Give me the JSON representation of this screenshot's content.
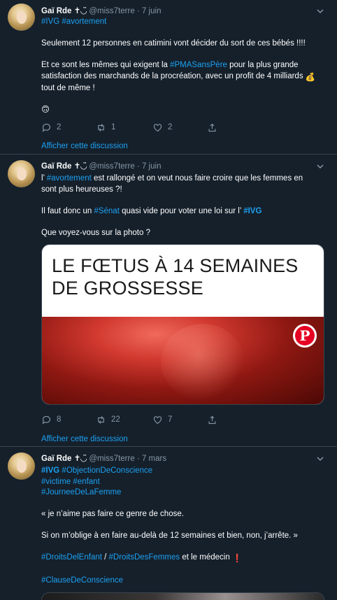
{
  "tweets": [
    {
      "name": "Gaï Rde",
      "name_symbol": "✝◡̈",
      "handle": "@miss7terre",
      "date": "7 juin",
      "hashtags": "#IVG #avortement",
      "text": {
        "l1": "Seulement 12 personnes en catimini vont décider du sort de ces bébés !!!!",
        "l2a": "Et ce sont les mêmes qui exigent la ",
        "l2tag": "#PMASansPère",
        "l2b": " pour la plus grande",
        "l3": "satisfaction des marchands de la procréation, avec un profit de 4 milliards ",
        "l3emoji": "💰",
        "l4": "tout de même !",
        "l5emoji": "🙃"
      },
      "replies": "2",
      "retweets": "1",
      "likes": "2",
      "thread_link": "Afficher cette discussion"
    },
    {
      "name": "Gaï Rde",
      "name_symbol": "✝◡̈",
      "handle": "@miss7terre",
      "date": "7 juin",
      "text": {
        "l1a": "l’ ",
        "l1tag": "#avortement",
        "l1b": " est rallongé et on veut nous faire croire que les femmes en",
        "l2": "sont plus heureuses ?!",
        "l3a": "Il faut donc un ",
        "l3tag1": "#Sénat",
        "l3b": " quasi vide pour voter une loi sur l’ ",
        "l3tag2": "#IVG",
        "l4": "Que voyez-vous sur la photo ?"
      },
      "card": {
        "title_l1": "LE FŒTUS À 14 SEMAINES",
        "title_l2": "DE GROSSESSE",
        "pin_glyph": "P"
      },
      "replies": "8",
      "retweets": "22",
      "likes": "7",
      "thread_link": "Afficher cette discussion"
    },
    {
      "name": "Gaï Rde",
      "name_symbol": "✝◡̈",
      "handle": "@miss7terre",
      "date": "7 mars",
      "text": {
        "h1a": "#IVG",
        "h1b": "#ObjectionDeConscience",
        "h2a": "#victime",
        "h2b": "#enfant",
        "h3": "#JourneeDeLaFemme",
        "l1": "« je n’aime pas faire ce genre de chose.",
        "l2": "Si on m’oblige à en faire au-delà de 12 semaines et bien, non, j’arrête. »",
        "l3tag1": "#DroitsDelEnfant",
        "l3sep": " / ",
        "l3tag2": "#DroitsDesFemmes",
        "l3b": " et le médecin ",
        "l3emoji": "❗",
        "l4tag": "#ClauseDeConscience"
      }
    }
  ],
  "colors": {
    "background": "#15202b",
    "text": "#ffffff",
    "muted": "#8899a6",
    "link": "#1da1f2",
    "divider": "#38444d"
  }
}
